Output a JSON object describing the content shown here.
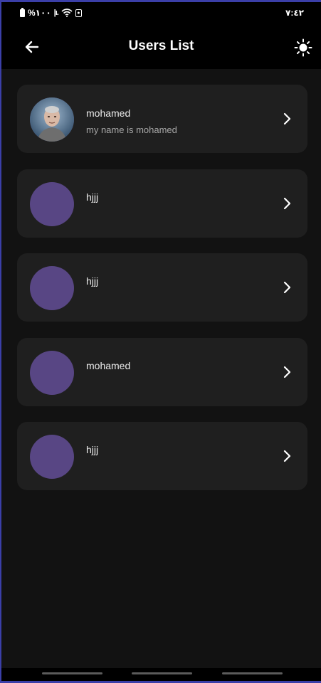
{
  "status_bar": {
    "battery": "%١٠٠",
    "time": "٧:٤٢",
    "icons": [
      "battery-icon",
      "signal-icon",
      "wifi-icon",
      "notification-icon"
    ]
  },
  "app_bar": {
    "title": "Users List",
    "back_icon": "arrow-left-icon",
    "theme_icon": "sun-icon"
  },
  "users": [
    {
      "name": "mohamed",
      "subtitle": "my name is mohamed",
      "has_photo": true
    },
    {
      "name": "hjjj",
      "subtitle": "",
      "has_photo": false
    },
    {
      "name": "hjjj",
      "subtitle": "",
      "has_photo": false
    },
    {
      "name": "mohamed",
      "subtitle": "",
      "has_photo": false
    },
    {
      "name": "hjjj",
      "subtitle": "",
      "has_photo": false
    }
  ],
  "colors": {
    "background": "#121212",
    "card": "#1f1f1f",
    "avatar_placeholder": "#584684",
    "app_bar": "#000000"
  }
}
